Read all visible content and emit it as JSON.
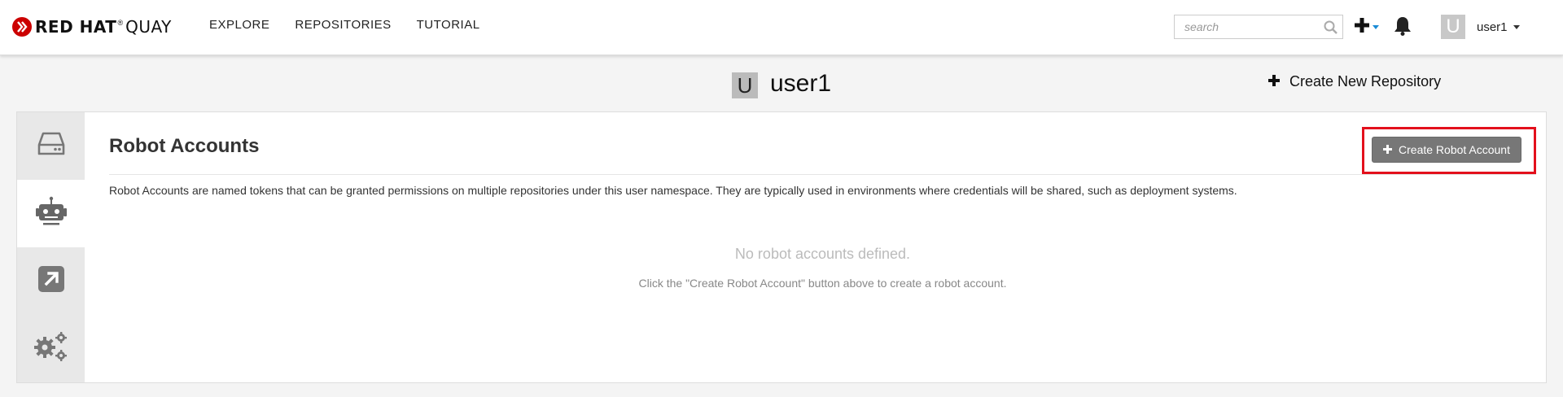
{
  "navbar": {
    "brand": {
      "red_hat": "RED HAT",
      "registered": "®",
      "quay": "QUAY"
    },
    "links": [
      {
        "label": "EXPLORE"
      },
      {
        "label": "REPOSITORIES"
      },
      {
        "label": "TUTORIAL"
      }
    ],
    "search": {
      "placeholder": "search",
      "value": ""
    },
    "user": {
      "avatar_letter": "U",
      "name": "user1"
    },
    "accent_color": "#1a8bd6"
  },
  "header": {
    "avatar_letter": "U",
    "username": "user1",
    "create_repo_label": "Create New Repository"
  },
  "sidebar": {
    "tabs": [
      {
        "icon": "hard-drive-icon",
        "active": false
      },
      {
        "icon": "robot-icon",
        "active": true
      },
      {
        "icon": "external-link-icon",
        "active": false
      },
      {
        "icon": "gears-icon",
        "active": false
      }
    ]
  },
  "robot_accounts": {
    "title": "Robot Accounts",
    "create_button_label": "Create Robot Account",
    "description": "Robot Accounts are named tokens that can be granted permissions on multiple repositories under this user namespace. They are typically used in environments where credentials will be shared, such as deployment systems.",
    "empty_title": "No robot accounts defined.",
    "empty_help": "Click the \"Create Robot Account\" button above to create a robot account.",
    "highlight_color": "#e3101c"
  }
}
